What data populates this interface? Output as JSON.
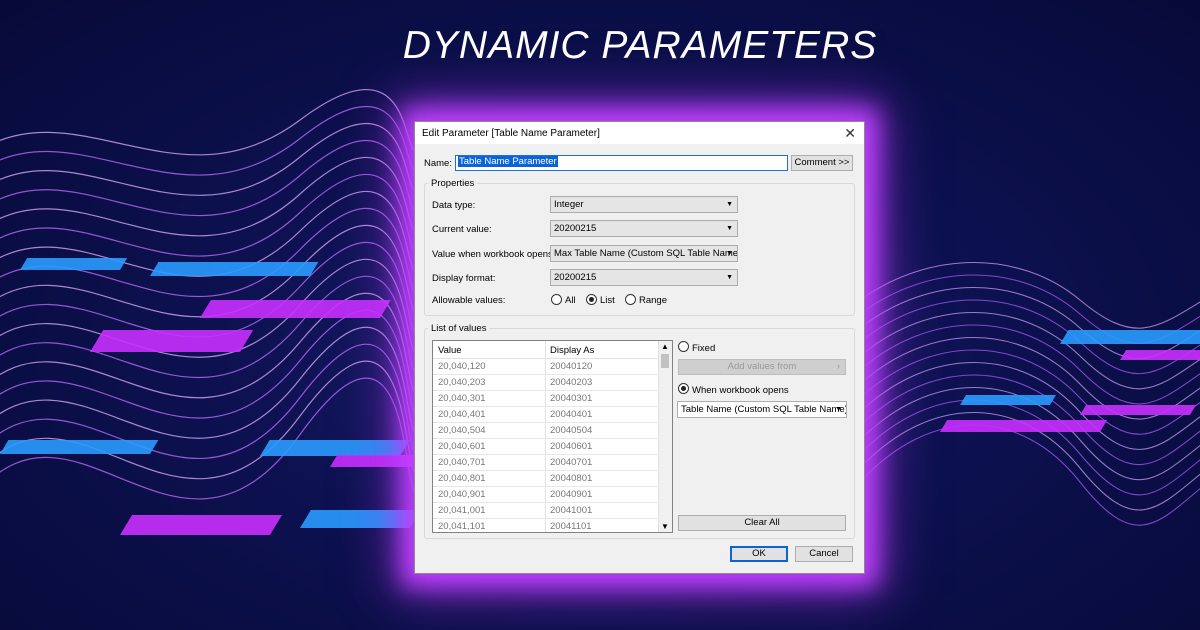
{
  "headline": "DYNAMIC PARAMETERS",
  "colors": {
    "accent": "#0a64d8",
    "glow": "#c040ff",
    "background": "#0d1150"
  },
  "dialog": {
    "title": "Edit Parameter [Table Name Parameter]",
    "name_label": "Name:",
    "name_value": "Table Name Parameter",
    "comment_button": "Comment >>",
    "properties": {
      "group_label": "Properties",
      "data_type_label": "Data type:",
      "data_type_value": "Integer",
      "current_value_label": "Current value:",
      "current_value": "20200215",
      "workbook_opens_label": "Value when workbook opens:",
      "workbook_opens_value": "Max Table Name (Custom SQL Table Name)",
      "display_format_label": "Display format:",
      "display_format_value": "20200215",
      "allowable_label": "Allowable values:",
      "allowable_options": [
        "All",
        "List",
        "Range"
      ],
      "allowable_selected": "List"
    },
    "list_of_values": {
      "group_label": "List of values",
      "columns": [
        "Value",
        "Display As"
      ],
      "rows": [
        [
          "20,040,120",
          "20040120"
        ],
        [
          "20,040,203",
          "20040203"
        ],
        [
          "20,040,301",
          "20040301"
        ],
        [
          "20,040,401",
          "20040401"
        ],
        [
          "20,040,504",
          "20040504"
        ],
        [
          "20,040,601",
          "20040601"
        ],
        [
          "20,040,701",
          "20040701"
        ],
        [
          "20,040,801",
          "20040801"
        ],
        [
          "20,040,901",
          "20040901"
        ],
        [
          "20,041,001",
          "20041001"
        ],
        [
          "20,041,101",
          "20041101"
        ]
      ],
      "fixed_label": "Fixed",
      "add_values_button": "Add values from",
      "when_opens_label": "When workbook opens",
      "when_opens_value": "Table Name (Custom SQL Table Name)",
      "clear_all_button": "Clear All"
    },
    "ok_button": "OK",
    "cancel_button": "Cancel"
  }
}
